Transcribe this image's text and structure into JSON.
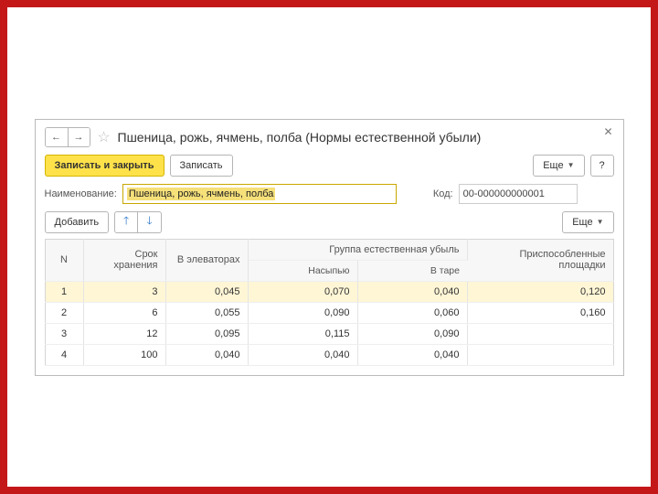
{
  "title": "Пшеница, рожь, ячмень, полба (Нормы естественной убыли)",
  "toolbar": {
    "save_close": "Записать и закрыть",
    "save": "Записать",
    "more": "Еще",
    "help": "?"
  },
  "fields": {
    "name_label": "Наименование:",
    "name_value": "Пшеница, рожь, ячмень, полба",
    "code_label": "Код:",
    "code_value": "00-000000000001"
  },
  "tabletools": {
    "add": "Добавить",
    "more": "Еще"
  },
  "columns": {
    "n": "N",
    "storage": "Срок хранения",
    "elevators": "В элеваторах",
    "group": "Группа естественная убыль",
    "bulk": "Насыпью",
    "bag": "В таре",
    "adapted": "Приспособленные площадки"
  },
  "rows": [
    {
      "n": "1",
      "storage": "3",
      "elev": "0,045",
      "bulk": "0,070",
      "bag": "0,040",
      "adapt": "0,120"
    },
    {
      "n": "2",
      "storage": "6",
      "elev": "0,055",
      "bulk": "0,090",
      "bag": "0,060",
      "adapt": "0,160"
    },
    {
      "n": "3",
      "storage": "12",
      "elev": "0,095",
      "bulk": "0,115",
      "bag": "0,090",
      "adapt": ""
    },
    {
      "n": "4",
      "storage": "100",
      "elev": "0,040",
      "bulk": "0,040",
      "bag": "0,040",
      "adapt": ""
    }
  ]
}
